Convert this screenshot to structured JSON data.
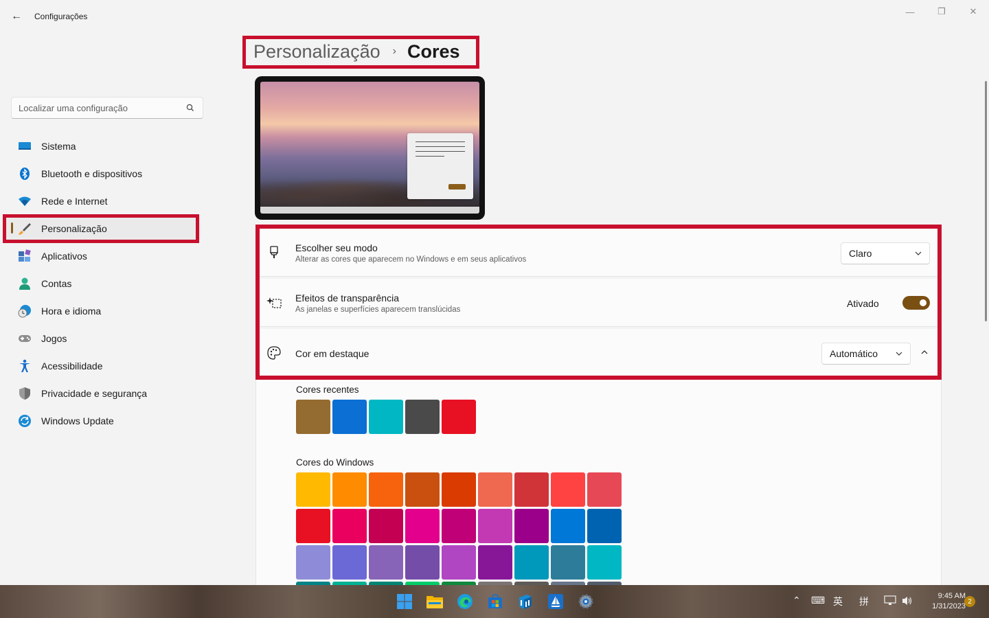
{
  "window": {
    "title": "Configurações",
    "back_glyph": "←",
    "minimize_glyph": "—",
    "maximize_glyph": "❐",
    "close_glyph": "✕"
  },
  "search": {
    "placeholder": "Localizar uma configuração"
  },
  "sidebar": {
    "items": [
      {
        "label": "Sistema",
        "icon": "monitor-icon"
      },
      {
        "label": "Bluetooth e dispositivos",
        "icon": "bluetooth-icon"
      },
      {
        "label": "Rede e Internet",
        "icon": "wifi-icon"
      },
      {
        "label": "Personalização",
        "icon": "brush-icon",
        "active": true
      },
      {
        "label": "Aplicativos",
        "icon": "apps-icon"
      },
      {
        "label": "Contas",
        "icon": "person-icon"
      },
      {
        "label": "Hora e idioma",
        "icon": "clock-globe-icon"
      },
      {
        "label": "Jogos",
        "icon": "gamepad-icon"
      },
      {
        "label": "Acessibilidade",
        "icon": "accessibility-icon"
      },
      {
        "label": "Privacidade e segurança",
        "icon": "shield-icon"
      },
      {
        "label": "Windows Update",
        "icon": "update-icon"
      }
    ]
  },
  "breadcrumb": {
    "parent": "Personalização",
    "separator": "›",
    "current": "Cores"
  },
  "settings": {
    "mode": {
      "title": "Escolher seu modo",
      "description": "Alterar as cores que aparecem no Windows e em seus aplicativos",
      "value": "Claro"
    },
    "transparency": {
      "title": "Efeitos de transparência",
      "description": "As janelas e superfícies aparecem translúcidas",
      "state_label": "Ativado",
      "on": true
    },
    "accent": {
      "title": "Cor em destaque",
      "value": "Automático",
      "expanded": true
    }
  },
  "recent_colors": {
    "label": "Cores recentes",
    "colors": [
      "#946b30",
      "#0b6fd4",
      "#00b7c3",
      "#4a4a4a",
      "#e81123"
    ]
  },
  "windows_colors": {
    "label": "Cores do Windows",
    "rows": [
      [
        "#ffb900",
        "#ff8c00",
        "#f7630c",
        "#ca5010",
        "#da3b01",
        "#ef6950",
        "#d13438",
        "#ff4343",
        "#e74856"
      ],
      [
        "#e81123",
        "#ea005e",
        "#c30052",
        "#e3008c",
        "#bf0077",
        "#c239b3",
        "#9a0089",
        "#0078d7",
        "#0063b1"
      ],
      [
        "#8e8cd8",
        "#6b69d6",
        "#8764b8",
        "#744da9",
        "#b146c2",
        "#881798",
        "#0099bc",
        "#2d7d9a",
        "#00b7c3"
      ],
      [
        "#038387",
        "#00b294",
        "#018574",
        "#00cc6a",
        "#10893e",
        "#7a7574",
        "#5d5a58",
        "#68768a",
        "#515c6b"
      ]
    ]
  },
  "taskbar": {
    "apps": [
      "start-icon",
      "file-explorer-icon",
      "edge-icon",
      "store-icon",
      "network-app-icon",
      "sailboat-app-icon",
      "settings-icon"
    ],
    "tray": {
      "chevron": "⌃",
      "keyboard": "⌨",
      "ime_mode": "英",
      "ime_name": "拼"
    },
    "time": "9:45 AM",
    "date": "1/31/2023",
    "notifications": "2"
  }
}
